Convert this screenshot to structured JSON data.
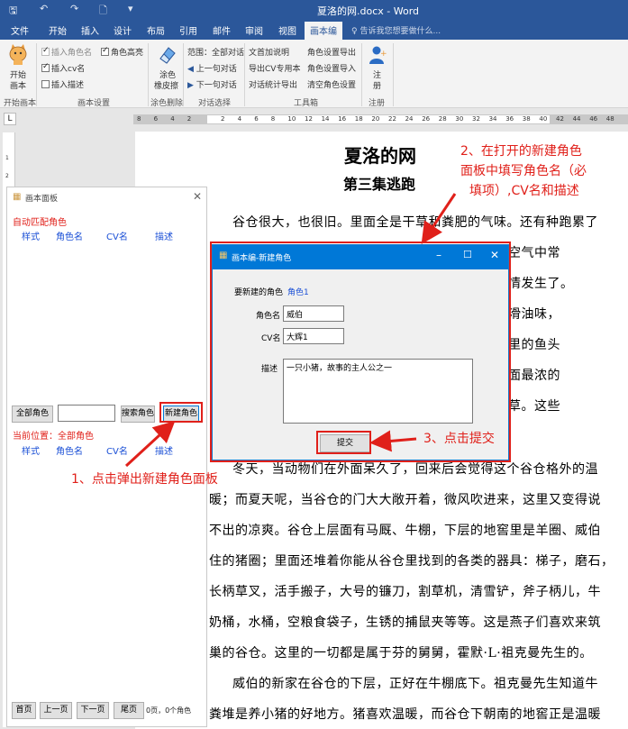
{
  "window": {
    "title": "夏洛的网.docx - Word",
    "quick_access": [
      "↶",
      "↷",
      "🗋",
      "▾"
    ]
  },
  "ribbon_tabs": [
    "文件",
    "开始",
    "插入",
    "设计",
    "布局",
    "引用",
    "邮件",
    "审阅",
    "视图",
    "画本编"
  ],
  "tell_me": "告诉我您想要做什么...",
  "ribbon": {
    "start_draw": {
      "label1": "开始",
      "label2": "画本",
      "group": "开始画本"
    },
    "settings": {
      "insert_role_name": "插入角色名",
      "role_highlight": "角色高亮",
      "insert_cv_name": "插入cv名",
      "insert_desc": "插入描述",
      "group": "画本设置"
    },
    "erase": {
      "label1": "涂色",
      "label2": "橡皮擦",
      "group": "涂色删除"
    },
    "dialog_select": {
      "range": "范围：全部对话",
      "prev": "上一句对话",
      "next": "下一句对话",
      "group": "对话选择"
    },
    "toolbox": {
      "c1": [
        "文首加说明",
        "导出CV专用本",
        "对话统计导出"
      ],
      "c2": [
        "角色设置导出",
        "角色设置导入",
        "清空角色设置"
      ],
      "group": "工具箱"
    },
    "register": {
      "label1": "注",
      "label2": "册",
      "group": "注册"
    }
  },
  "ruler": {
    "corner": "L",
    "ticks": [
      "8",
      "6",
      "4",
      "2",
      "",
      "2",
      "4",
      "6",
      "8",
      "10",
      "12",
      "14",
      "16",
      "18",
      "20",
      "22",
      "24",
      "26",
      "28",
      "30",
      "32",
      "34",
      "36",
      "38",
      "40",
      "42",
      "44",
      "46",
      "48"
    ]
  },
  "document": {
    "title": "夏洛的网",
    "subtitle": "第三集逃跑",
    "lines": [
      "谷仓很大，也很旧。里面全是干草和粪肥的气味。还有种跑累了",
      "空气中常",
      "情发生了。",
      "滑油味，",
      "里的鱼头",
      "面最浓的",
      "草。这些",
      "冬天，当动物们在外面呆久了，回来后会觉得这个谷仓格外的温",
      "暖；而夏天呢，当谷仓的门大大敞开着，微风吹进来，这里又变得说",
      "不出的凉爽。谷仓上层面有马厩、牛棚，下层的地窖里是羊圈、威伯",
      "住的猪圈；里面还堆着你能从谷仓里找到的各类的器具：梯子，磨石，",
      "长柄草叉，活手搬子，大号的镰刀，割草机，清雪铲，斧子柄儿，牛",
      "奶桶，水桶，空粮食袋子，生锈的捕鼠夹等等。这是燕子们喜欢来筑",
      "巢的谷仓。这里的一切都是属于芬的舅舅，霍默·L·祖克曼先生的。",
      "威伯的新家在谷仓的下层，正好在牛棚底下。祖克曼先生知道牛",
      "粪堆是养小猪的好地方。猪喜欢温暖，而谷仓下朝南的地窖正是温暖"
    ]
  },
  "panel": {
    "title": "画本面板",
    "auto_match": "自动匹配角色",
    "headers": [
      "样式",
      "角色名",
      "CV名",
      "描述"
    ],
    "all_roles_btn": "全部角色",
    "search_btn": "搜索角色",
    "new_role_btn": "新建角色",
    "current_location": "当前位置：全部角色",
    "pager": [
      "首页",
      "上一页",
      "下一页",
      "尾页"
    ],
    "page_info": "0页，0个角色"
  },
  "dialog": {
    "title": "画本编-新建角色",
    "new_role_label": "要新建的角色",
    "new_role_value": "角色1",
    "role_name_label": "角色名",
    "role_name_value": "威伯",
    "cv_label": "CV名",
    "cv_value": "大辉1",
    "desc_label": "描述",
    "desc_value": "一只小猪，故事的主人公之一",
    "submit": "提交"
  },
  "annotations": {
    "step1": "1、点击弹出新建角色面板",
    "step2_line1": "2、在打开的新建角色",
    "step2_line2": "面板中填写角色名（必",
    "step2_line3": "填项）,CV名和描述",
    "step3": "3、点击提交"
  },
  "colors": {
    "word_blue": "#2b579a",
    "dialog_title": "#0078d7",
    "annotation_red": "#e0201a",
    "link_blue": "#1a4fd6"
  }
}
